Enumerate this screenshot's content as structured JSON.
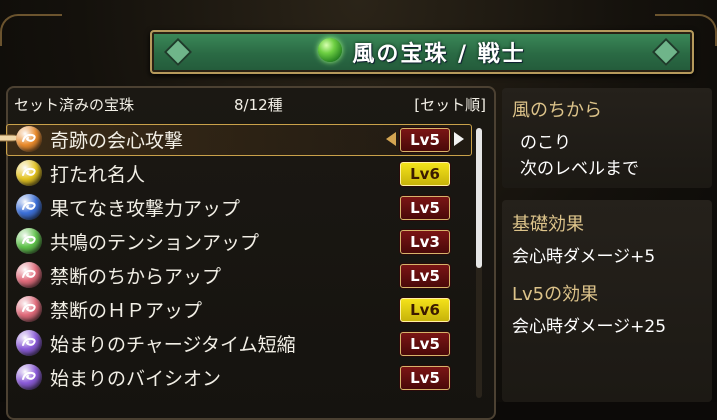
{
  "title": "風の宝珠 / 戦士",
  "list": {
    "header": "セット済みの宝珠",
    "count": "8/12種",
    "sort": "[セット順]",
    "items": [
      {
        "name": "奇跡の会心攻撃",
        "level": "Lv5",
        "color": "#e8892a",
        "badge": "red",
        "selected": true
      },
      {
        "name": "打たれ名人",
        "level": "Lv6",
        "color": "#e3c21e",
        "badge": "gold",
        "selected": false
      },
      {
        "name": "果てなき攻撃力アップ",
        "level": "Lv5",
        "color": "#3b6fd8",
        "badge": "red",
        "selected": false
      },
      {
        "name": "共鳴のテンションアップ",
        "level": "Lv3",
        "color": "#5ec24a",
        "badge": "red",
        "selected": false
      },
      {
        "name": "禁断のちからアップ",
        "level": "Lv5",
        "color": "#e06a7a",
        "badge": "red",
        "selected": false
      },
      {
        "name": "禁断のＨＰアップ",
        "level": "Lv6",
        "color": "#e06a7a",
        "badge": "gold",
        "selected": false
      },
      {
        "name": "始まりのチャージタイム短縮",
        "level": "Lv5",
        "color": "#8a5ad8",
        "badge": "red",
        "selected": false
      },
      {
        "name": "始まりのバイシオン",
        "level": "Lv5",
        "color": "#8a5ad8",
        "badge": "red",
        "selected": false
      }
    ]
  },
  "info": {
    "element_title": "風のちから",
    "remaining": "のこり",
    "next_level": "次のレベルまで",
    "base_title": "基礎効果",
    "base_effect": "会心時ダメージ+5",
    "lv_title": "Lv5の効果",
    "lv_effect": "会心時ダメージ+25"
  },
  "colors": {
    "banner": "#2a6a44",
    "badge_red": "#6a1010",
    "badge_gold": "#e6d414",
    "label_gold": "#dcc38a"
  }
}
